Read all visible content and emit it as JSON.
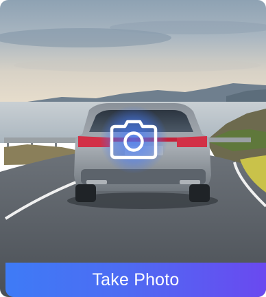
{
  "card": {
    "button_label": "Take Photo",
    "overlay_icon": "camera-icon"
  },
  "colors": {
    "button_gradient_start": "#3e7bf6",
    "button_gradient_end": "#6a49f0",
    "overlay_glow": "#4078ff",
    "label": "#ffffff"
  }
}
